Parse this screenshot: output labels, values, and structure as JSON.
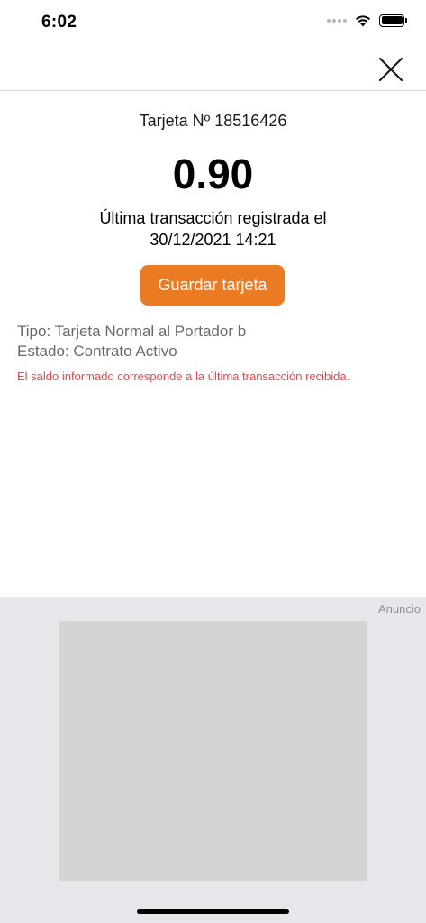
{
  "status_bar": {
    "time": "6:02",
    "icons": [
      "signal-dots-icon",
      "wifi-icon",
      "battery-icon"
    ]
  },
  "nav": {
    "close_icon": "close-icon"
  },
  "card": {
    "number_label": "Tarjeta Nº 18516426",
    "balance": "0.90",
    "last_transaction_line1": "Última transacción registrada el",
    "last_transaction_line2": "30/12/2021 14:21",
    "save_button_label": "Guardar tarjeta",
    "type_line": "Tipo: Tarjeta Normal al Portador b",
    "status_line": "Estado: Contrato Activo",
    "warning_text": "El saldo informado corresponde a la última transacción recibida."
  },
  "ad": {
    "label": "Anuncio"
  },
  "colors": {
    "accent": "#ea7b23",
    "warning": "#e8454a",
    "ad_background": "#e6e6eb",
    "ad_placeholder": "#d4d4d4"
  }
}
